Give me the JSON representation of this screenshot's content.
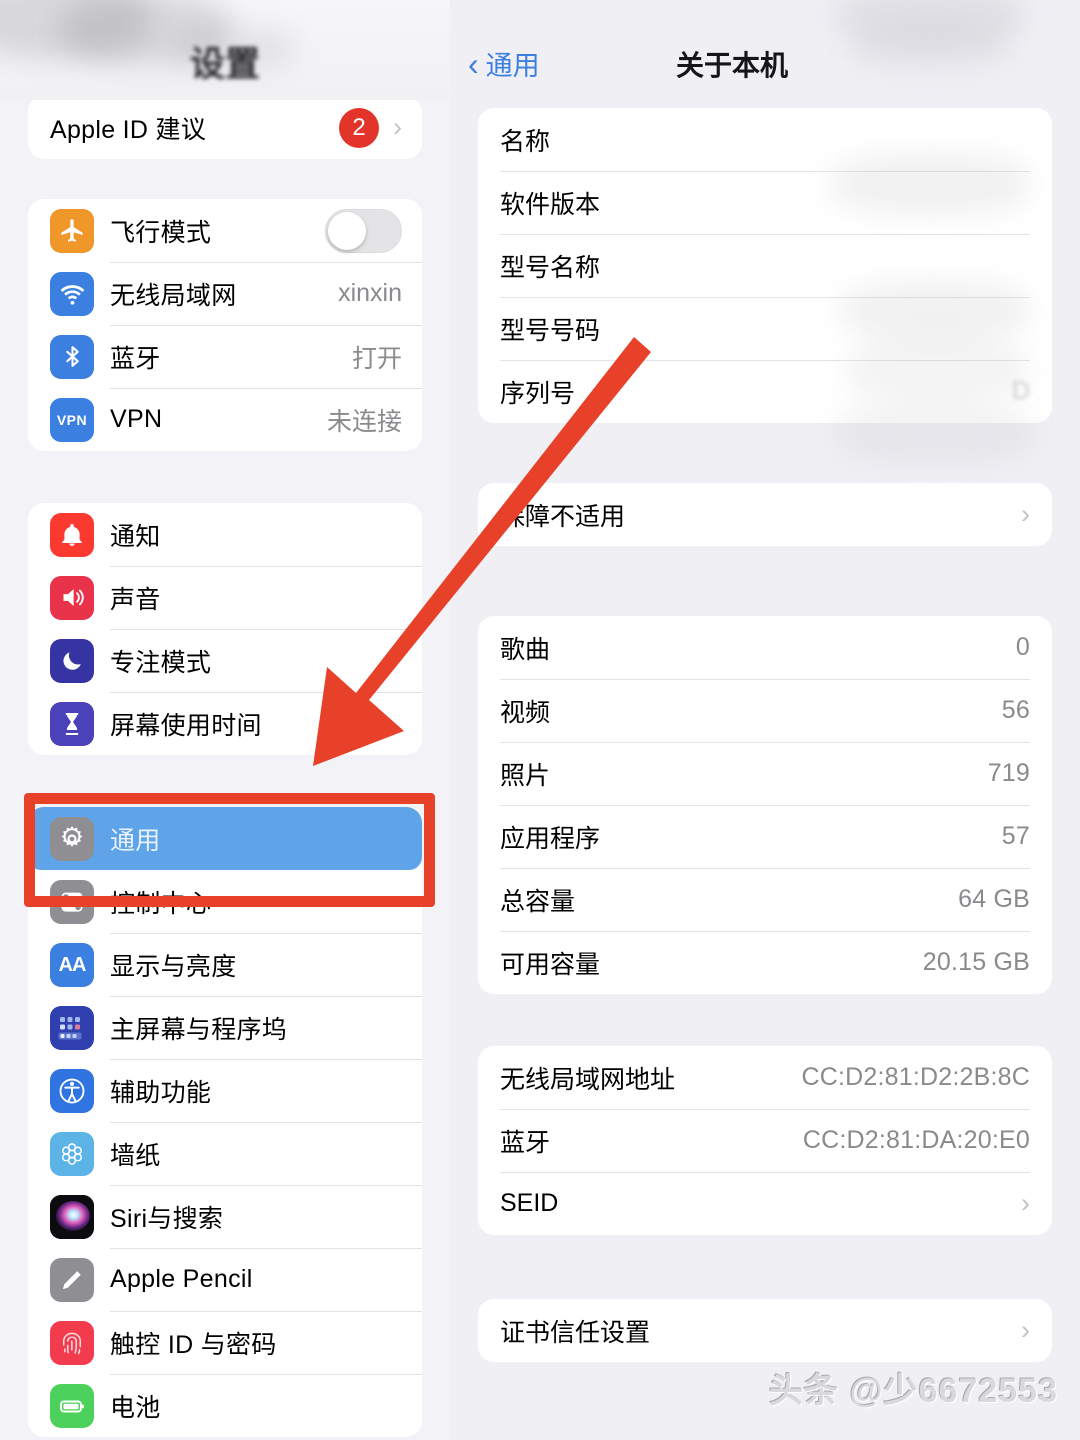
{
  "sidebar": {
    "title": "设置",
    "apple_id_row": {
      "label": "Apple ID 建议",
      "badge": "2",
      "chevron": "›"
    },
    "group_connectivity": [
      {
        "label": "飞行模式",
        "value": "",
        "icon": "airplane-icon",
        "color": "#f0972a",
        "control": "toggle",
        "toggle_on": false
      },
      {
        "label": "无线局域网",
        "value": "xinxin",
        "icon": "wifi-icon",
        "color": "#3b7fe0",
        "control": "value"
      },
      {
        "label": "蓝牙",
        "value": "打开",
        "icon": "bluetooth-icon",
        "color": "#3b7fe0",
        "control": "value"
      },
      {
        "label": "VPN",
        "value": "未连接",
        "icon": "vpn-icon",
        "color": "#3b7fe0",
        "control": "value"
      }
    ],
    "group_alerts": [
      {
        "label": "通知",
        "icon": "bell-icon",
        "color": "#fa3a2e"
      },
      {
        "label": "声音",
        "icon": "speaker-icon",
        "color": "#e8334a"
      },
      {
        "label": "专注模式",
        "icon": "moon-icon",
        "color": "#3634a3"
      },
      {
        "label": "屏幕使用时间",
        "icon": "hourglass-icon",
        "color": "#4b41b8"
      }
    ],
    "group_system": [
      {
        "label": "通用",
        "icon": "gear-icon",
        "color": "#8e8e93",
        "selected": true
      },
      {
        "label": "控制中心",
        "icon": "toggles-icon",
        "color": "#8e8e93",
        "selected": false
      },
      {
        "label": "显示与亮度",
        "icon": "aa-icon",
        "color": "#3b7fe0",
        "selected": false
      },
      {
        "label": "主屏幕与程序坞",
        "icon": "home-grid-icon",
        "color": "#2f3fae",
        "selected": false
      },
      {
        "label": "辅助功能",
        "icon": "accessibility-icon",
        "color": "#2f74e0",
        "selected": false
      },
      {
        "label": "墙纸",
        "icon": "wallpaper-icon",
        "color": "#5bb4e5",
        "selected": false
      },
      {
        "label": "Siri与搜索",
        "icon": "siri-icon",
        "color": "#1a1a1a",
        "selected": false
      },
      {
        "label": "Apple Pencil",
        "icon": "pencil-icon",
        "color": "#8e8e93",
        "selected": false
      },
      {
        "label": "触控 ID 与密码",
        "icon": "fingerprint-icon",
        "color": "#f23b4d",
        "selected": false
      },
      {
        "label": "电池",
        "icon": "battery-icon",
        "color": "#4cd15c",
        "selected": false
      }
    ]
  },
  "detail": {
    "back_label": "通用",
    "back_icon": "chevron-left-icon",
    "title": "关于本机",
    "card_device": [
      {
        "label": "名称",
        "value": "",
        "blurred": true
      },
      {
        "label": "软件版本",
        "value": "",
        "blurred": true
      },
      {
        "label": "型号名称",
        "value": "",
        "blurred": true
      },
      {
        "label": "型号号码",
        "value": "",
        "blurred": true
      },
      {
        "label": "序列号",
        "value": "D",
        "blurred": true
      }
    ],
    "card_coverage": [
      {
        "label": "保障不适用",
        "chevron": "›"
      }
    ],
    "card_stats": [
      {
        "label": "歌曲",
        "value": "0"
      },
      {
        "label": "视频",
        "value": "56"
      },
      {
        "label": "照片",
        "value": "719"
      },
      {
        "label": "应用程序",
        "value": "57"
      },
      {
        "label": "总容量",
        "value": "64 GB"
      },
      {
        "label": "可用容量",
        "value": "20.15 GB"
      }
    ],
    "card_network": [
      {
        "label": "无线局域网地址",
        "value": "CC:D2:81:D2:2B:8C"
      },
      {
        "label": "蓝牙",
        "value": "CC:D2:81:DA:20:E0"
      },
      {
        "label": "SEID",
        "value": "",
        "chevron": "›"
      }
    ],
    "card_certs": [
      {
        "label": "证书信任设置",
        "chevron": "›"
      }
    ]
  },
  "annotations": {
    "highlight_color": "#e8412a",
    "arrow_color": "#e8412a",
    "selected_row_color": "#5fa3e8"
  },
  "watermark": {
    "text": "头条 @少6672553"
  }
}
